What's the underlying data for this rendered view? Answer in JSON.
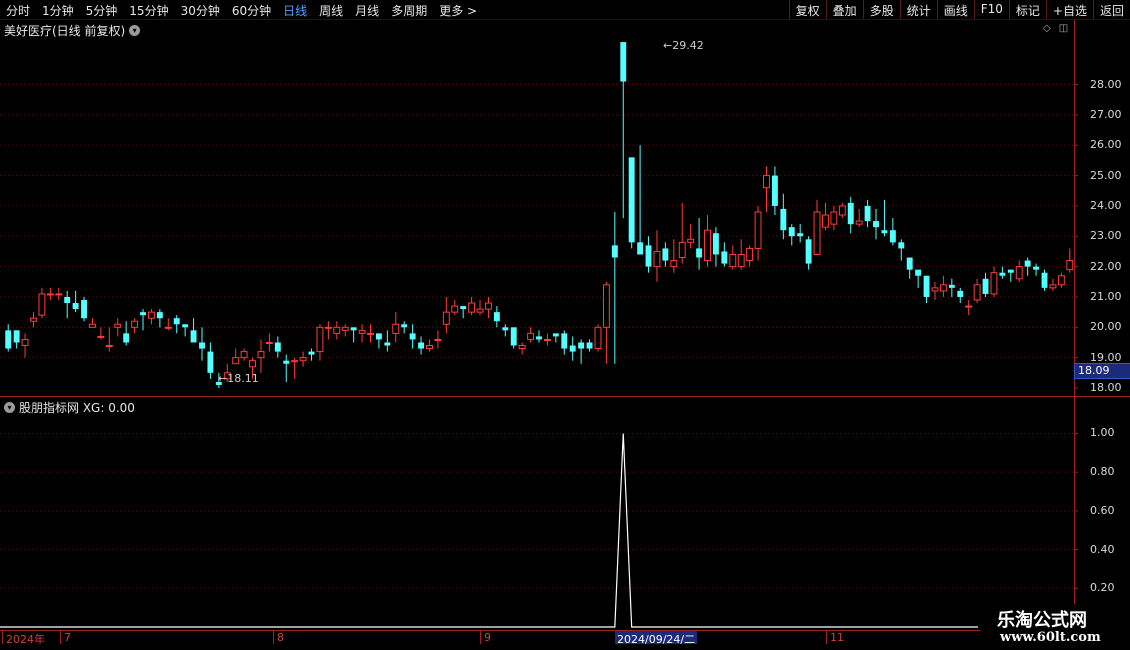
{
  "toolbar": {
    "periods": [
      "分时",
      "1分钟",
      "5分钟",
      "15分钟",
      "30分钟",
      "60分钟",
      "日线",
      "周线",
      "月线",
      "多周期",
      "更多 >"
    ],
    "active_period": "日线",
    "actions": [
      "复权",
      "叠加",
      "多股",
      "统计",
      "画线",
      "F10",
      "标记",
      "+自选",
      "返回"
    ]
  },
  "main_chart": {
    "title": "美好医疗(日线 前复权)",
    "high_label": "29.42",
    "low_label": "18.11",
    "current_price_tag": "18.09",
    "y_ticks": [
      "28.00",
      "27.00",
      "26.00",
      "25.00",
      "24.00",
      "23.00",
      "22.00",
      "21.00",
      "20.00",
      "19.00",
      "18.00"
    ]
  },
  "indicator": {
    "title": "股朋指标网  XG: 0.00",
    "y_ticks": [
      "1.00",
      "0.80",
      "0.60",
      "0.40",
      "0.20"
    ]
  },
  "date_axis": {
    "labels": [
      "2024年",
      "7",
      "8",
      "9",
      "11"
    ],
    "selected": "2024/09/24/二"
  },
  "watermark": {
    "line1": "乐淘公式网",
    "line2": "www.60lt.com"
  },
  "colors": {
    "up": "#ff3c3c",
    "down": "#54ffff",
    "background": "#000000",
    "axis": "#a02222"
  },
  "chart_data": {
    "type": "candlestick",
    "ylim": [
      18,
      29.6
    ],
    "candles": [
      [
        19.9,
        19.3,
        20.1,
        19.2
      ],
      [
        19.9,
        19.5,
        19.9,
        19.3
      ],
      [
        19.4,
        19.6,
        19.8,
        19.0
      ],
      [
        20.2,
        20.3,
        20.5,
        20.0
      ],
      [
        20.4,
        21.1,
        21.3,
        20.3
      ],
      [
        21.1,
        21.1,
        21.3,
        20.9
      ],
      [
        21.1,
        21.1,
        21.3,
        20.9
      ],
      [
        21.0,
        20.8,
        21.2,
        20.3
      ],
      [
        20.8,
        20.6,
        21.2,
        20.5
      ],
      [
        20.9,
        20.3,
        21.0,
        20.2
      ],
      [
        20.0,
        20.1,
        20.3,
        20.0
      ],
      [
        19.7,
        19.7,
        20.0,
        19.6
      ],
      [
        19.4,
        19.4,
        20.0,
        19.2
      ],
      [
        20.0,
        20.1,
        20.3,
        19.7
      ],
      [
        19.8,
        19.5,
        20.2,
        19.4
      ],
      [
        20.0,
        20.2,
        20.3,
        19.8
      ],
      [
        20.5,
        20.4,
        20.6,
        19.9
      ],
      [
        20.3,
        20.5,
        20.6,
        20.1
      ],
      [
        20.5,
        20.3,
        20.6,
        20.0
      ],
      [
        20.0,
        20.0,
        20.3,
        19.9
      ],
      [
        20.3,
        20.1,
        20.4,
        19.8
      ],
      [
        20.1,
        20.0,
        20.1,
        19.7
      ],
      [
        19.9,
        19.5,
        20.3,
        19.5
      ],
      [
        19.5,
        19.3,
        20.0,
        18.9
      ],
      [
        19.2,
        18.5,
        19.5,
        18.3
      ],
      [
        18.2,
        18.1,
        18.5,
        18.0
      ],
      [
        18.3,
        18.5,
        18.8,
        18.2
      ],
      [
        18.8,
        19.0,
        19.3,
        18.8
      ],
      [
        19.0,
        19.2,
        19.3,
        18.9
      ],
      [
        18.7,
        18.9,
        19.0,
        18.3
      ],
      [
        19.0,
        19.2,
        19.6,
        18.5
      ],
      [
        19.5,
        19.5,
        19.8,
        19.2
      ],
      [
        19.5,
        19.2,
        19.7,
        19.0
      ],
      [
        18.9,
        18.8,
        19.1,
        18.2
      ],
      [
        18.9,
        18.9,
        19.0,
        18.3
      ],
      [
        18.9,
        19.0,
        19.2,
        18.7
      ],
      [
        19.2,
        19.1,
        19.3,
        18.9
      ],
      [
        19.2,
        20.0,
        20.1,
        18.9
      ],
      [
        20.0,
        20.0,
        20.2,
        19.6
      ],
      [
        19.8,
        20.0,
        20.2,
        19.6
      ],
      [
        19.9,
        20.0,
        20.1,
        19.7
      ],
      [
        20.0,
        19.9,
        20.0,
        19.5
      ],
      [
        19.8,
        19.9,
        20.1,
        19.5
      ],
      [
        19.8,
        19.8,
        20.1,
        19.5
      ],
      [
        19.8,
        19.6,
        19.8,
        19.3
      ],
      [
        19.5,
        19.4,
        19.9,
        19.2
      ],
      [
        19.8,
        20.1,
        20.5,
        19.5
      ],
      [
        20.1,
        20.0,
        20.2,
        19.8
      ],
      [
        19.8,
        19.6,
        20.1,
        19.3
      ],
      [
        19.5,
        19.3,
        19.7,
        19.1
      ],
      [
        19.3,
        19.4,
        19.6,
        19.2
      ],
      [
        19.6,
        19.6,
        19.9,
        19.3
      ],
      [
        20.1,
        20.5,
        21.0,
        19.8
      ],
      [
        20.5,
        20.7,
        20.9,
        20.4
      ],
      [
        20.7,
        20.6,
        20.7,
        20.3
      ],
      [
        20.5,
        20.8,
        21.0,
        20.4
      ],
      [
        20.5,
        20.6,
        20.9,
        20.4
      ],
      [
        20.6,
        20.8,
        21.0,
        20.3
      ],
      [
        20.5,
        20.2,
        20.7,
        20.0
      ],
      [
        20.0,
        19.9,
        20.1,
        19.7
      ],
      [
        20.0,
        19.4,
        20.0,
        19.3
      ],
      [
        19.3,
        19.4,
        19.5,
        19.1
      ],
      [
        19.6,
        19.8,
        20.0,
        19.5
      ],
      [
        19.7,
        19.6,
        19.9,
        19.5
      ],
      [
        19.6,
        19.6,
        19.8,
        19.4
      ],
      [
        19.8,
        19.7,
        19.8,
        19.5
      ],
      [
        19.8,
        19.3,
        19.9,
        19.1
      ],
      [
        19.4,
        19.2,
        19.7,
        18.9
      ],
      [
        19.5,
        19.3,
        19.6,
        18.8
      ],
      [
        19.5,
        19.3,
        19.6,
        19.2
      ],
      [
        19.3,
        20.0,
        20.1,
        19.2
      ],
      [
        20.0,
        21.4,
        21.5,
        18.8
      ],
      [
        22.7,
        22.3,
        23.8,
        18.8
      ],
      [
        29.4,
        28.1,
        29.4,
        23.6
      ],
      [
        25.6,
        22.8,
        25.6,
        22.6
      ],
      [
        22.8,
        22.4,
        26.0,
        22.6
      ],
      [
        22.7,
        22.0,
        23.0,
        21.8
      ],
      [
        22.0,
        22.5,
        23.2,
        21.5
      ],
      [
        22.6,
        22.2,
        22.8,
        22.0
      ],
      [
        22.0,
        22.2,
        22.9,
        21.8
      ],
      [
        22.3,
        22.8,
        24.1,
        22.1
      ],
      [
        22.8,
        22.9,
        23.4,
        22.6
      ],
      [
        22.6,
        22.3,
        23.6,
        21.9
      ],
      [
        22.2,
        23.2,
        23.7,
        22.0
      ],
      [
        23.1,
        22.4,
        23.3,
        22.0
      ],
      [
        22.5,
        22.1,
        22.8,
        22.0
      ],
      [
        22.0,
        22.4,
        22.7,
        21.9
      ],
      [
        22.0,
        22.4,
        22.9,
        21.9
      ],
      [
        22.2,
        22.6,
        22.7,
        22.0
      ],
      [
        22.6,
        23.8,
        24.0,
        22.2
      ],
      [
        24.6,
        25.0,
        25.3,
        23.8
      ],
      [
        25.0,
        24.0,
        25.3,
        23.7
      ],
      [
        23.9,
        23.2,
        24.4,
        22.9
      ],
      [
        23.3,
        23.0,
        23.4,
        22.7
      ],
      [
        23.1,
        23.0,
        23.4,
        22.8
      ],
      [
        22.9,
        22.1,
        23.0,
        21.9
      ],
      [
        22.4,
        23.8,
        24.2,
        22.4
      ],
      [
        23.3,
        23.7,
        24.1,
        23.2
      ],
      [
        23.4,
        23.8,
        24.0,
        23.2
      ],
      [
        23.7,
        24.0,
        24.1,
        23.6
      ],
      [
        24.1,
        23.4,
        24.3,
        23.1
      ],
      [
        23.4,
        23.5,
        23.9,
        23.3
      ],
      [
        24.0,
        23.5,
        24.2,
        23.3
      ],
      [
        23.5,
        23.3,
        23.9,
        22.9
      ],
      [
        23.2,
        23.1,
        24.2,
        23.0
      ],
      [
        23.2,
        22.8,
        23.6,
        22.7
      ],
      [
        22.8,
        22.6,
        22.9,
        22.2
      ],
      [
        22.3,
        21.9,
        22.3,
        21.6
      ],
      [
        21.9,
        21.7,
        21.8,
        21.3
      ],
      [
        21.7,
        21.0,
        21.7,
        20.8
      ],
      [
        21.2,
        21.3,
        21.5,
        20.9
      ],
      [
        21.2,
        21.4,
        21.7,
        21.0
      ],
      [
        21.4,
        21.3,
        21.6,
        21.0
      ],
      [
        21.2,
        21.0,
        21.3,
        20.8
      ],
      [
        20.7,
        20.7,
        20.9,
        20.4
      ],
      [
        20.9,
        21.4,
        21.6,
        20.8
      ],
      [
        21.6,
        21.1,
        21.8,
        21.0
      ],
      [
        21.1,
        21.8,
        22.0,
        21.0
      ],
      [
        21.8,
        21.7,
        22.0,
        21.6
      ],
      [
        21.9,
        21.8,
        21.9,
        21.5
      ],
      [
        21.6,
        22.0,
        22.2,
        21.5
      ],
      [
        22.2,
        22.0,
        22.3,
        21.7
      ],
      [
        22.0,
        21.9,
        22.1,
        21.7
      ],
      [
        21.8,
        21.3,
        21.9,
        21.2
      ],
      [
        21.3,
        21.4,
        21.6,
        21.2
      ],
      [
        21.4,
        21.7,
        21.8,
        21.3
      ],
      [
        21.9,
        22.2,
        22.6,
        21.8
      ]
    ],
    "indicator_series": {
      "name": "XG",
      "ylim": [
        0,
        1.08
      ],
      "spike_index": 73,
      "spike_value": 1.0
    }
  }
}
